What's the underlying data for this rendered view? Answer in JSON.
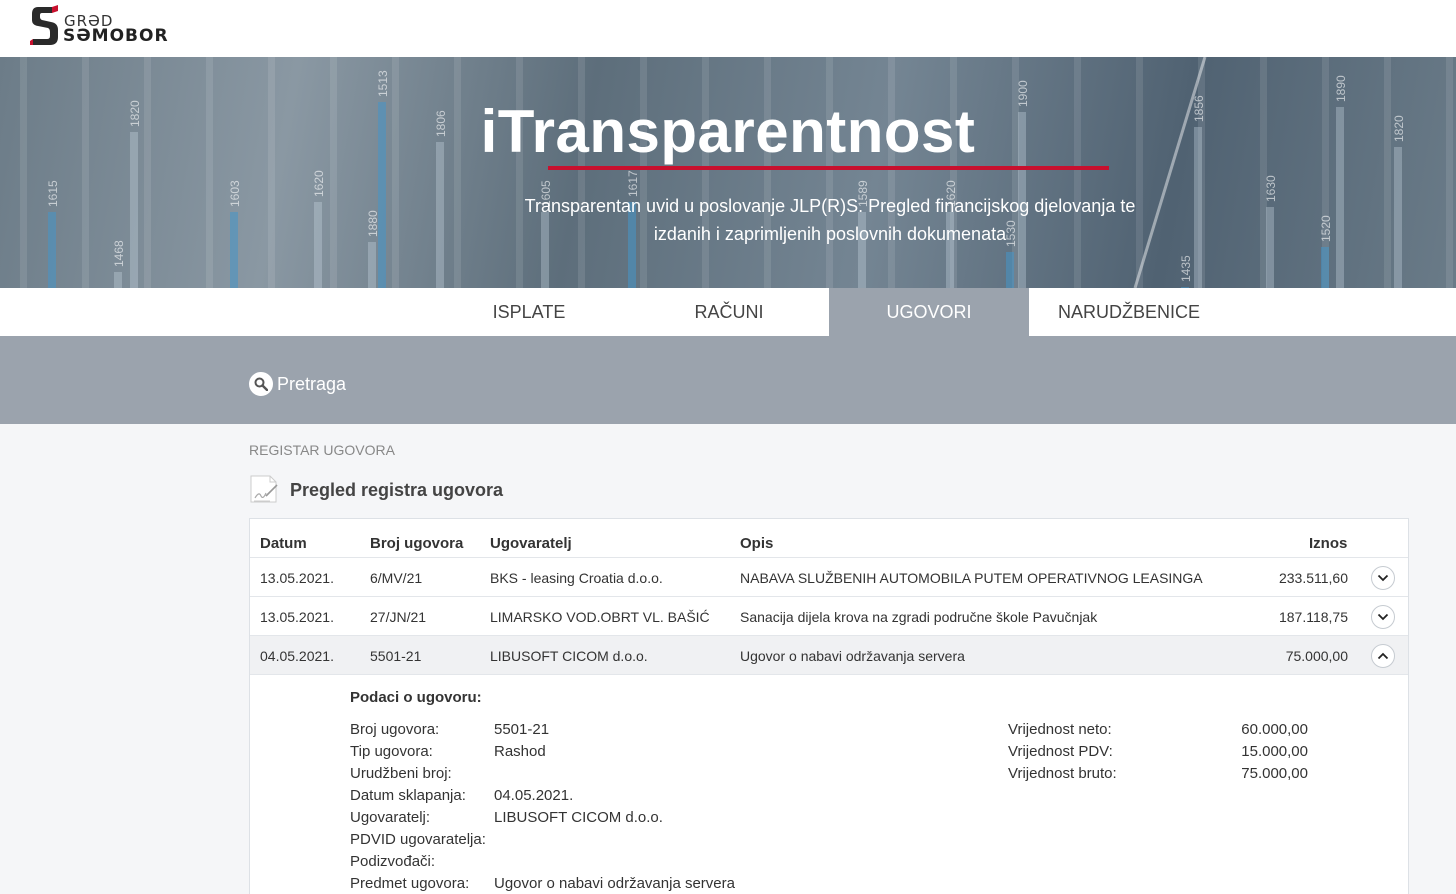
{
  "header": {
    "logo_small": "GRƏD",
    "logo_big": "SƏMOBOR"
  },
  "hero": {
    "title": "iTransparentnost",
    "subtitle": "Transparentan uvid u poslovanje JLP(R)S. Pregled financijskog djelovanja te izdanih i zaprimljenih poslovnih dokumenata",
    "bg_numbers": [
      "1615",
      "1468",
      "1820",
      "1603",
      "1620",
      "1880",
      "1513",
      "1806",
      "1605",
      "1617",
      "1589",
      "1620",
      "1530",
      "1900",
      "1856",
      "1435",
      "1630",
      "1890",
      "1520",
      "1820"
    ]
  },
  "tabs": [
    {
      "label": "ISPLATE",
      "active": false
    },
    {
      "label": "RAČUNI",
      "active": false
    },
    {
      "label": "UGOVORI",
      "active": true
    },
    {
      "label": "NARUDŽBENICE",
      "active": false
    }
  ],
  "search": {
    "label": "Pretraga"
  },
  "breadcrumb": "REGISTAR UGOVORA",
  "section_title": "Pregled registra ugovora",
  "table": {
    "headers": {
      "datum": "Datum",
      "broj": "Broj ugovora",
      "ugovaratelj": "Ugovaratelj",
      "opis": "Opis",
      "iznos": "Iznos"
    },
    "rows": [
      {
        "datum": "13.05.2021.",
        "broj": "6/MV/21",
        "ugovaratelj": "BKS - leasing Croatia d.o.o.",
        "opis": "NABAVA SLUŽBENIH AUTOMOBILA PUTEM OPERATIVNOG LEASINGA",
        "iznos": "233.511,60",
        "expanded": false
      },
      {
        "datum": "13.05.2021.",
        "broj": "27/JN/21",
        "ugovaratelj": "LIMARSKO VOD.OBRT VL. BAŠIĆ",
        "opis": "Sanacija dijela krova na zgradi područne škole Pavučnjak",
        "iznos": "187.118,75",
        "expanded": false
      },
      {
        "datum": "04.05.2021.",
        "broj": "5501-21",
        "ugovaratelj": "LIBUSOFT CICOM d.o.o.",
        "opis": "Ugovor o nabavi održavanja servera",
        "iznos": "75.000,00",
        "expanded": true
      }
    ]
  },
  "details": {
    "title": "Podaci o ugovoru:",
    "left": [
      {
        "label": "Broj ugovora:",
        "value": "5501-21"
      },
      {
        "label": "Tip ugovora:",
        "value": "Rashod"
      },
      {
        "label": "Urudžbeni broj:",
        "value": ""
      },
      {
        "label": "Datum sklapanja:",
        "value": "04.05.2021."
      },
      {
        "label": "Ugovaratelj:",
        "value": "LIBUSOFT CICOM d.o.o."
      },
      {
        "label": "PDVID ugovaratelja:",
        "value": ""
      },
      {
        "label": "Podizvođači:",
        "value": ""
      },
      {
        "label": "Predmet ugovora:",
        "value": "Ugovor o nabavi održavanja servera"
      }
    ],
    "right": [
      {
        "label": "Vrijednost neto:",
        "value": "60.000,00"
      },
      {
        "label": "Vrijednost PDV:",
        "value": "15.000,00"
      },
      {
        "label": "Vrijednost bruto:",
        "value": "75.000,00"
      }
    ]
  },
  "colors": {
    "accent_red": "#c8102e",
    "tab_active_bg": "#9ba3ad",
    "search_band": "#9ba3ad"
  }
}
